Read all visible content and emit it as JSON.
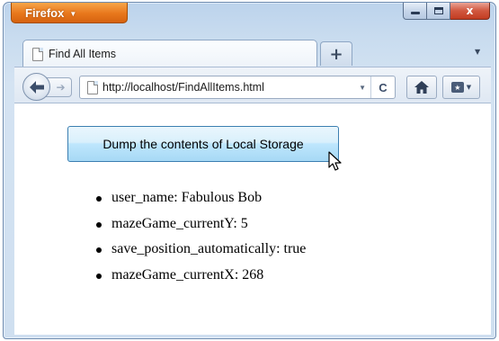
{
  "window": {
    "app_button_label": "Firefox",
    "controls": {
      "close_glyph": "x"
    }
  },
  "tabs": [
    {
      "label": "Find All Items",
      "icon": "page-icon"
    }
  ],
  "new_tab_glyph": "+",
  "navbar": {
    "back_icon": "back-arrow-icon",
    "forward_icon": "forward-arrow-icon",
    "url": "http://localhost/FindAllItems.html",
    "reload_glyph": "C",
    "home_icon": "home-icon",
    "bookmarks_icon": "bookmarks-icon"
  },
  "page": {
    "dump_button_label": "Dump the contents of Local Storage",
    "items": [
      "user_name: Fabulous Bob",
      "mazeGame_currentY: 5",
      "save_position_automatically: true",
      "mazeGame_currentX: 268"
    ]
  },
  "colors": {
    "firefox_orange": "#e8771c",
    "close_red": "#c23c22",
    "button_blue": "#bee6fd"
  }
}
